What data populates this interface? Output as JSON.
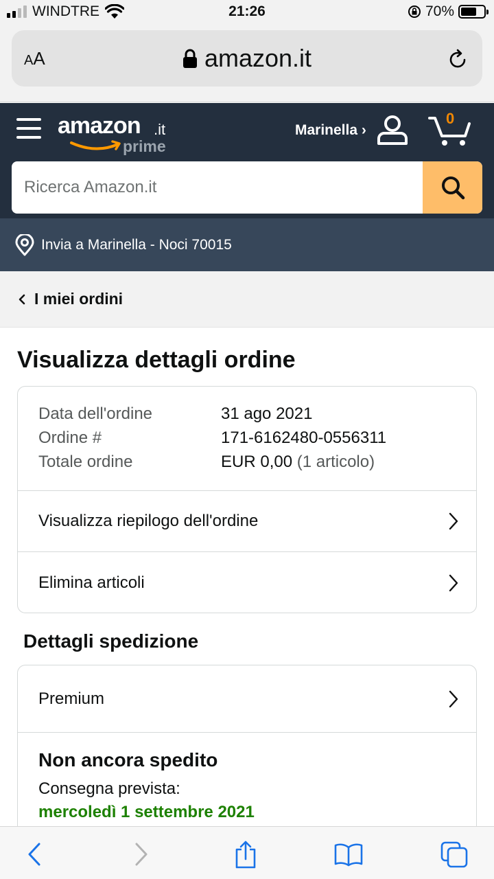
{
  "status_bar": {
    "carrier": "WINDTRE",
    "time": "21:26",
    "battery_percent": "70%",
    "battery_level": 0.7
  },
  "browser": {
    "text_size_label": "AA",
    "url": "amazon.it"
  },
  "header": {
    "logo_text": "amazon",
    "logo_tld": ".it",
    "logo_sub": "prime",
    "account_label": "Marinella ›",
    "cart_count": "0",
    "search_placeholder": "Ricerca Amazon.it"
  },
  "delivery": {
    "text": "Invia a Marinella - Noci 70015"
  },
  "breadcrumb": {
    "label": "I miei ordini"
  },
  "page": {
    "title": "Visualizza dettagli ordine"
  },
  "order": {
    "rows": [
      {
        "label": "Data dell'ordine",
        "value": "31 ago 2021"
      },
      {
        "label": "Ordine #",
        "value": "171-6162480-0556311"
      },
      {
        "label": "Totale ordine",
        "value": "EUR 0,00",
        "extra": "(1 articolo)"
      }
    ],
    "links": [
      {
        "label": "Visualizza riepilogo dell'ordine"
      },
      {
        "label": "Elimina articoli"
      }
    ]
  },
  "shipping": {
    "section_title": "Dettagli spedizione",
    "method": "Premium",
    "status": "Non ancora spedito",
    "expected_label": "Consegna prevista:",
    "expected_date": "mercoledì 1 settembre 2021"
  },
  "colors": {
    "header_bg": "#232f3e",
    "delivery_bg": "#37475a",
    "search_button": "#febd69",
    "cart_count": "#f08804",
    "delivery_date": "#1d8102",
    "safari_blue": "#1a73e8"
  }
}
